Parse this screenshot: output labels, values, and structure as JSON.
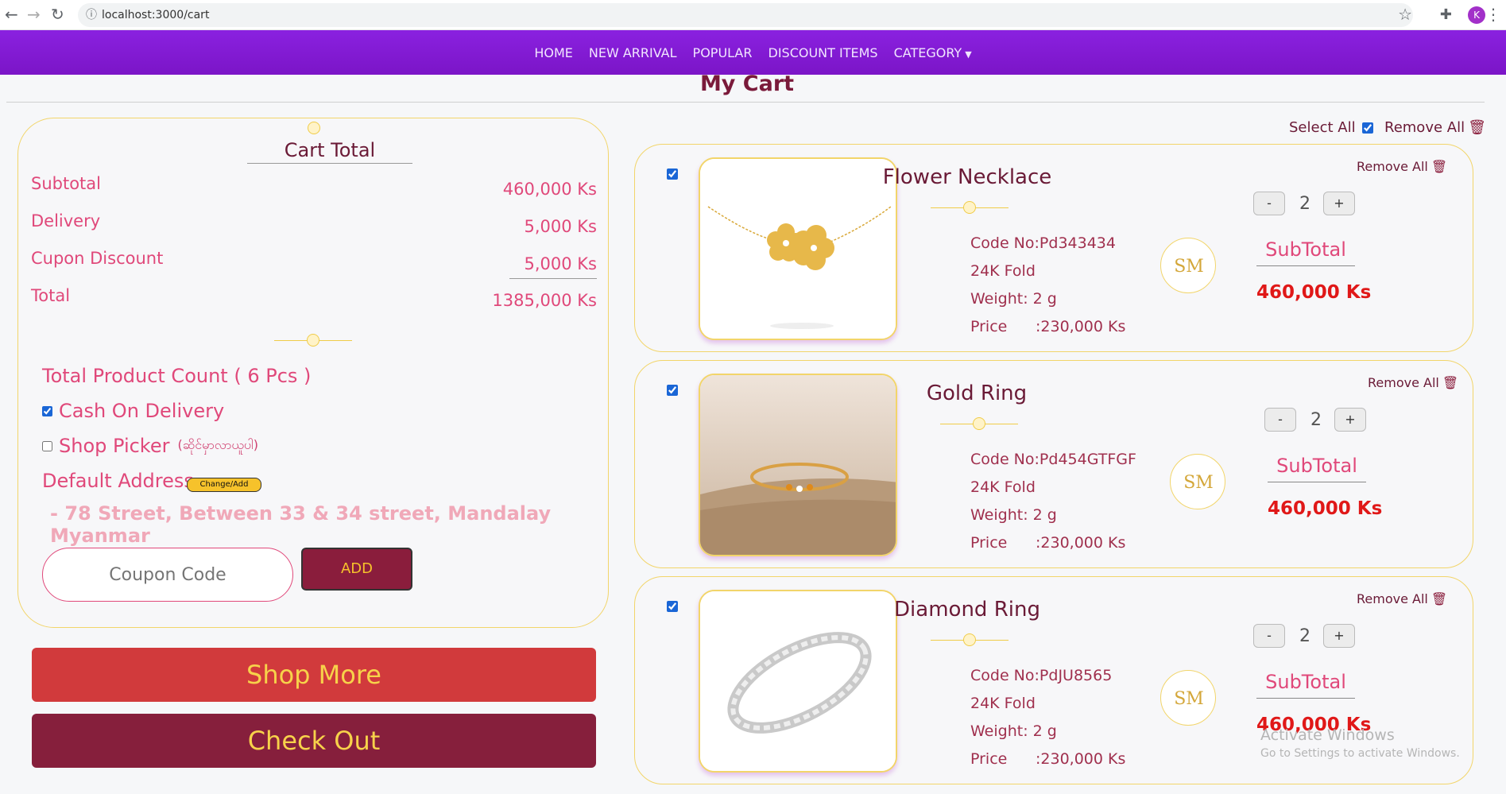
{
  "browser": {
    "url": "localhost:3000/cart",
    "avatar_initial": "K"
  },
  "nav": {
    "items": [
      "HOME",
      "NEW ARRIVAL",
      "POPULAR",
      "DISCOUNT ITEMS",
      "CATEGORY"
    ]
  },
  "page_title": "My Cart",
  "summary": {
    "heading": "Cart Total",
    "rows": [
      {
        "label": "Subtotal",
        "value": "460,000 Ks"
      },
      {
        "label": "Delivery",
        "value": "5,000 Ks"
      },
      {
        "label": "Cupon Discount",
        "value": "5,000 Ks"
      },
      {
        "label": "Total",
        "value": "1385,000 Ks"
      }
    ],
    "product_count": "Total Product Count ( 6 Pcs )",
    "cash_on_delivery": "Cash On Delivery",
    "cash_on_delivery_checked": true,
    "shop_picker": "Shop Picker",
    "shop_picker_note": "(ဆိုင်မှာလာယူပါ)",
    "shop_picker_checked": false,
    "default_address_label": "Default Address",
    "change_add": "Change/Add",
    "address": "- 78 Street, Between 33 & 34 street, Mandalay Myanmar",
    "coupon_placeholder": "Coupon Code",
    "add_label": "ADD",
    "shop_more": "Shop More",
    "check_out": "Check Out"
  },
  "select_all": "Select All",
  "remove_all": "Remove All",
  "colors": {
    "nav_bg": "#8a21e0",
    "accent": "#e0487a",
    "button_dark": "#861f3c",
    "button_red": "#d13a3c",
    "gold": "#f2d56a"
  },
  "items": [
    {
      "name": "Flower Necklace",
      "code": "Code No:Pd343434",
      "fold": "24K Fold",
      "weight": "Weight: 2 g",
      "price_label": "Price",
      "price": ":230,000 Ks",
      "qty": "2",
      "minus": "-",
      "plus": "+",
      "remove": "Remove All",
      "subtotal_label": "SubTotal",
      "subtotal": "460,000 Ks"
    },
    {
      "name": "Gold Ring",
      "code": "Code No:Pd454GTFGF",
      "fold": "24K Fold",
      "weight": "Weight: 2 g",
      "price_label": "Price",
      "price": ":230,000 Ks",
      "qty": "2",
      "minus": "-",
      "plus": "+",
      "remove": "Remove All",
      "subtotal_label": "SubTotal",
      "subtotal": "460,000 Ks"
    },
    {
      "name": "Diamond Ring",
      "code": "Code No:PdJU8565",
      "fold": "24K Fold",
      "weight": "Weight: 2 g",
      "price_label": "Price",
      "price": ":230,000 Ks",
      "qty": "2",
      "minus": "-",
      "plus": "+",
      "remove": "Remove All",
      "subtotal_label": "SubTotal",
      "subtotal": "460,000 Ks"
    }
  ],
  "watermark": {
    "line1": "Activate Windows",
    "line2": "Go to Settings to activate Windows."
  }
}
